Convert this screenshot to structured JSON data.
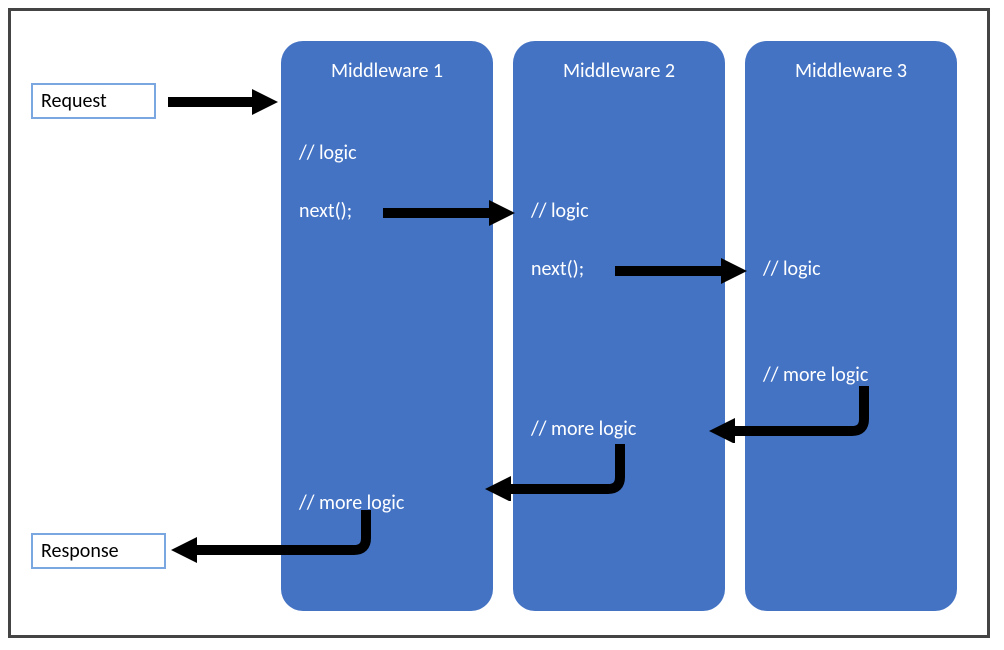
{
  "labels": {
    "request": "Request",
    "response": "Response"
  },
  "middlewares": [
    {
      "title": "Middleware 1",
      "logic": "// logic",
      "next": "next();",
      "morelogic": "// more logic"
    },
    {
      "title": "Middleware 2",
      "logic": "// logic",
      "next": "next();",
      "morelogic": "// more logic"
    },
    {
      "title": "Middleware 3",
      "logic": "// logic",
      "morelogic": "// more logic"
    }
  ]
}
